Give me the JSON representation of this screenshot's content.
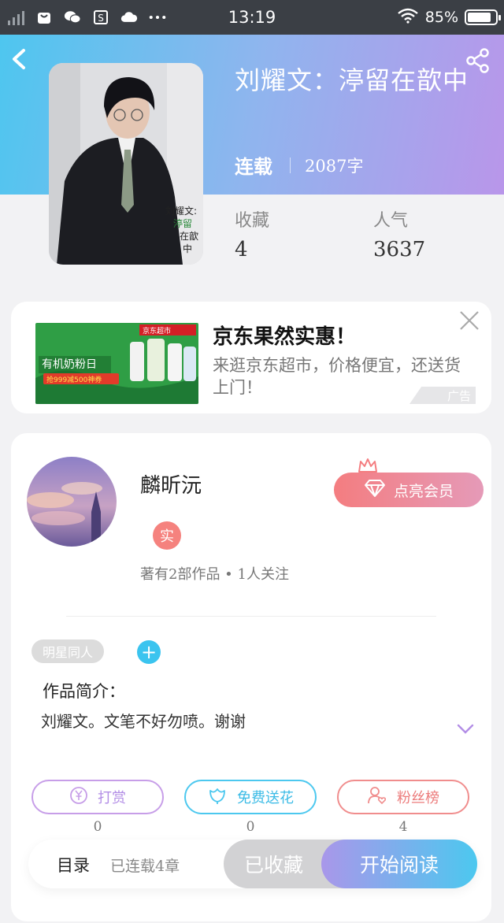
{
  "status_bar": {
    "time": "13:19",
    "battery": "85%"
  },
  "book": {
    "title": "刘耀文：渟留在歆中",
    "status": "连载",
    "word_count": "2087字",
    "stats": [
      {
        "label": "收藏",
        "value": "4"
      },
      {
        "label": "人气",
        "value": "3637"
      }
    ]
  },
  "ad": {
    "title": "京东果然实惠！",
    "description": "来逛京东超市，价格便宜，还送货上门！",
    "badge": "广告",
    "image_texts": {
      "store": "京东超市",
      "headline": "有机奶粉日",
      "promo": "抢999减500神券"
    }
  },
  "author": {
    "name": "麟昕沅",
    "verified_label": "实",
    "stats": "著有2部作品 • 1人关注",
    "vip_button": "点亮会员"
  },
  "work": {
    "tag": "明星同人",
    "intro_label": "作品简介：",
    "intro_text": "刘耀文。文笔不好勿喷。谢谢"
  },
  "actions": [
    {
      "label": "打赏",
      "count": "0",
      "color": "#c79ee8"
    },
    {
      "label": "免费送花",
      "count": "0",
      "color": "#4cc8ef"
    },
    {
      "label": "粉丝榜",
      "count": "4",
      "color": "#f08d8d"
    }
  ],
  "bottom_bar": {
    "toc": "目录",
    "chapters": "已连载4章",
    "collect": "已收藏",
    "read": "开始阅读"
  },
  "colors": {
    "accent_blue": "#4cc8ef",
    "accent_purple": "#b996ea",
    "vip": "#f47d80"
  }
}
